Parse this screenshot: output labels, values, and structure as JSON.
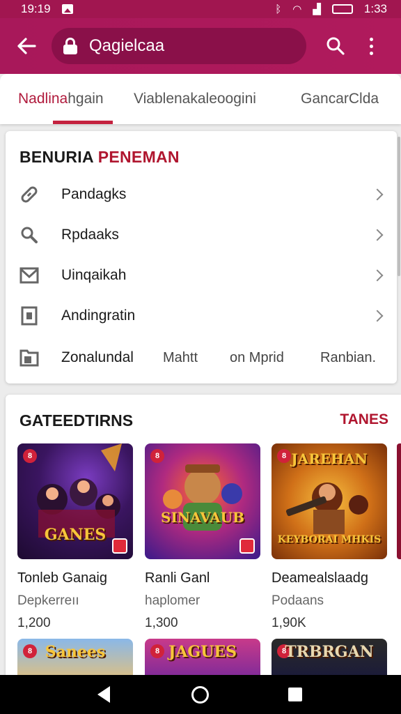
{
  "status_bar": {
    "time": "19:19",
    "right_time": "1:33"
  },
  "app_bar": {
    "search_text": "Qagielcaa"
  },
  "tabs": [
    {
      "label_prefix": "Nadlina",
      "label_suffix": "hgain",
      "active": true
    },
    {
      "label": "Viablenakale­oogini",
      "active": false
    },
    {
      "label": "GancarClda",
      "active": false
    }
  ],
  "menu_card": {
    "title_part1": "BENURIA",
    "title_part2": "PENEMAN",
    "items": [
      {
        "label": "Pandagks",
        "icon": "link-icon"
      },
      {
        "label": "Rpdaaks",
        "icon": "search-icon"
      },
      {
        "label": "Uinqaikah",
        "icon": "mail-icon"
      },
      {
        "label": "Andingratin",
        "icon": "card-icon"
      },
      {
        "label": "Zonalundal",
        "icon": "folder-icon"
      }
    ],
    "last_row_extras": [
      "Mahtt",
      "on Mprid",
      "Ranbian."
    ]
  },
  "games_section": {
    "title": "GATEEDTIRNS",
    "link": "TANES",
    "games": [
      {
        "name": "Tonleb Ganaig",
        "sub": "Depkerreıı",
        "count": "1,200",
        "art_text": "GANES",
        "badge": "8"
      },
      {
        "name": "Ranli Ganl",
        "sub": "haplomer",
        "count": "1,300",
        "art_text": "SINAVAUB",
        "badge": "8"
      },
      {
        "name": "Deamealslaadg",
        "sub": "Podaans",
        "count": "1,90K",
        "art_text_top": "JAREHAN",
        "art_text": "KEYBORAI MHKIS",
        "badge": "8"
      }
    ],
    "next_row": [
      {
        "art_text": "Sanees",
        "badge": "8"
      },
      {
        "art_text": "JAGUES",
        "badge": "8"
      },
      {
        "art_text": "TRBRGAN",
        "badge": "8"
      }
    ]
  },
  "colors": {
    "brand": "#a8185a",
    "accent": "#b0162f"
  }
}
